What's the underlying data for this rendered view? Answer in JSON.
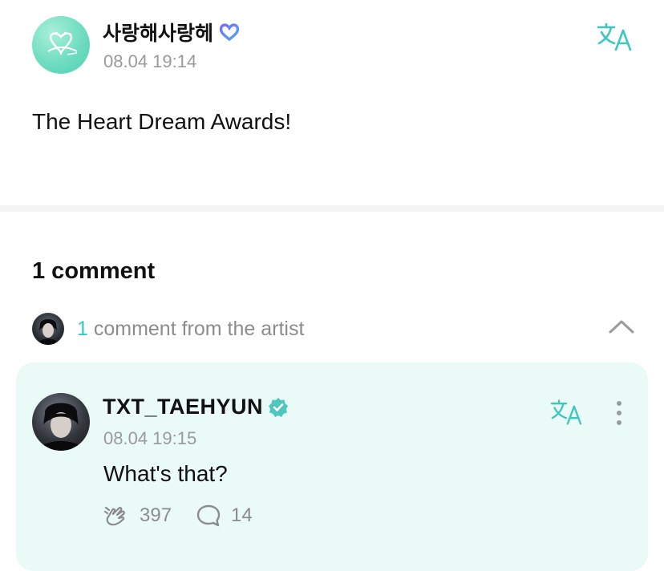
{
  "post": {
    "author": "사랑해사랑헤",
    "time": "08.04 19:14",
    "body": "The Heart Dream Awards!",
    "badge_icon": "heart-weverse-icon",
    "translate_icon": "translate-icon"
  },
  "comments": {
    "count_label": "1 comment",
    "artist_summary": {
      "count": "1",
      "text": " comment from the artist"
    }
  },
  "artist_comment": {
    "author": "TXT_TAEHYUN",
    "verified_icon": "verified-badge-icon",
    "time": "08.04 19:15",
    "text": "What's that?",
    "likes": "397",
    "replies": "14"
  },
  "colors": {
    "accent": "#3ec6c0",
    "card_bg": "#eafaf6",
    "muted_text": "#9a9a9a"
  }
}
